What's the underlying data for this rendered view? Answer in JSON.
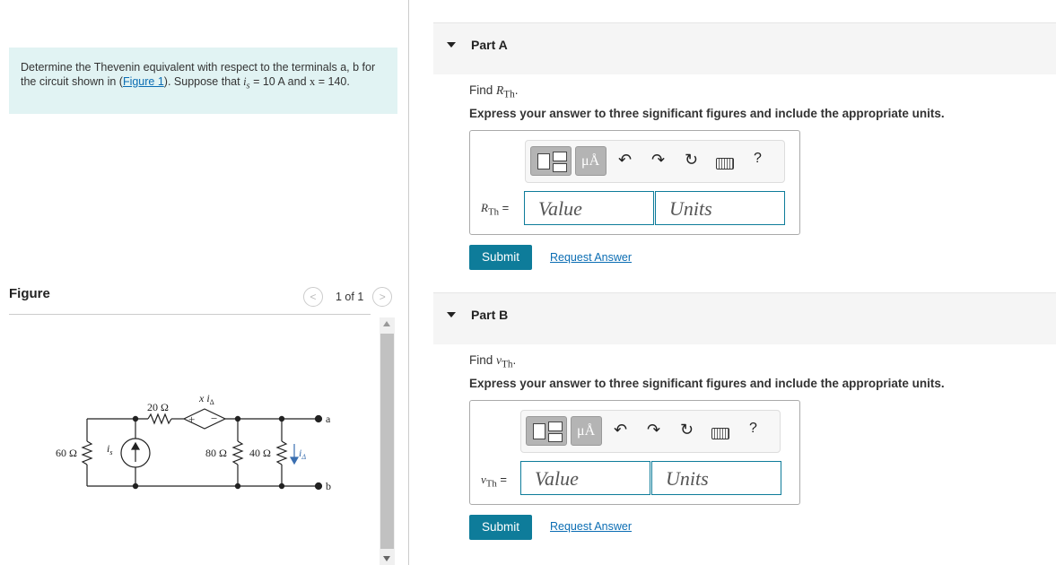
{
  "problem": {
    "text_before_link": "Determine the Thevenin equivalent with respect to the terminals a, b for the circuit shown in (",
    "link": "Figure 1",
    "text_mid": "). Suppose that ",
    "is_symbol": "i",
    "is_sub": "s",
    "is_value": " = 10 A and ",
    "x_symbol": "x",
    "x_value": " = 140."
  },
  "figure": {
    "title": "Figure",
    "pager": "1 of 1",
    "circuit": {
      "r1": "60 Ω",
      "source": "i",
      "source_sub": "s",
      "r2": "20 Ω",
      "dep_source": "x i",
      "dep_sub": "Δ",
      "plus": "+",
      "minus": "−",
      "r3": "80 Ω",
      "r4": "40 Ω",
      "current": "i",
      "current_sub": "Δ",
      "term_a": "a",
      "term_b": "b"
    }
  },
  "parts": [
    {
      "title": "Part A",
      "find_prefix": "Find ",
      "find_var": "R",
      "find_sub": "Th",
      "find_suffix": ".",
      "instructions": "Express your answer to three significant figures and include the appropriate units.",
      "label_var": "R",
      "label_sub": "Th",
      "label_eq": " =",
      "value_placeholder": "Value",
      "units_placeholder": "Units",
      "submit": "Submit",
      "request": "Request Answer"
    },
    {
      "title": "Part B",
      "find_prefix": "Find ",
      "find_var": "v",
      "find_sub": "Th",
      "find_suffix": ".",
      "instructions": "Express your answer to three significant figures and include the appropriate units.",
      "label_var": "v",
      "label_sub": "Th",
      "label_eq": " =",
      "value_placeholder": "Value",
      "units_placeholder": "Units",
      "submit": "Submit",
      "request": "Request Answer"
    }
  ],
  "toolbar": {
    "units_button": "μÅ",
    "help": "?",
    "icons": [
      "templates-icon",
      "units-icon",
      "undo-icon",
      "redo-icon",
      "reset-icon",
      "keyboard-icon",
      "help-icon"
    ]
  },
  "colors": {
    "accent": "#0e7c9a",
    "link": "#0b6db3",
    "problem_bg": "#e1f3f3"
  }
}
